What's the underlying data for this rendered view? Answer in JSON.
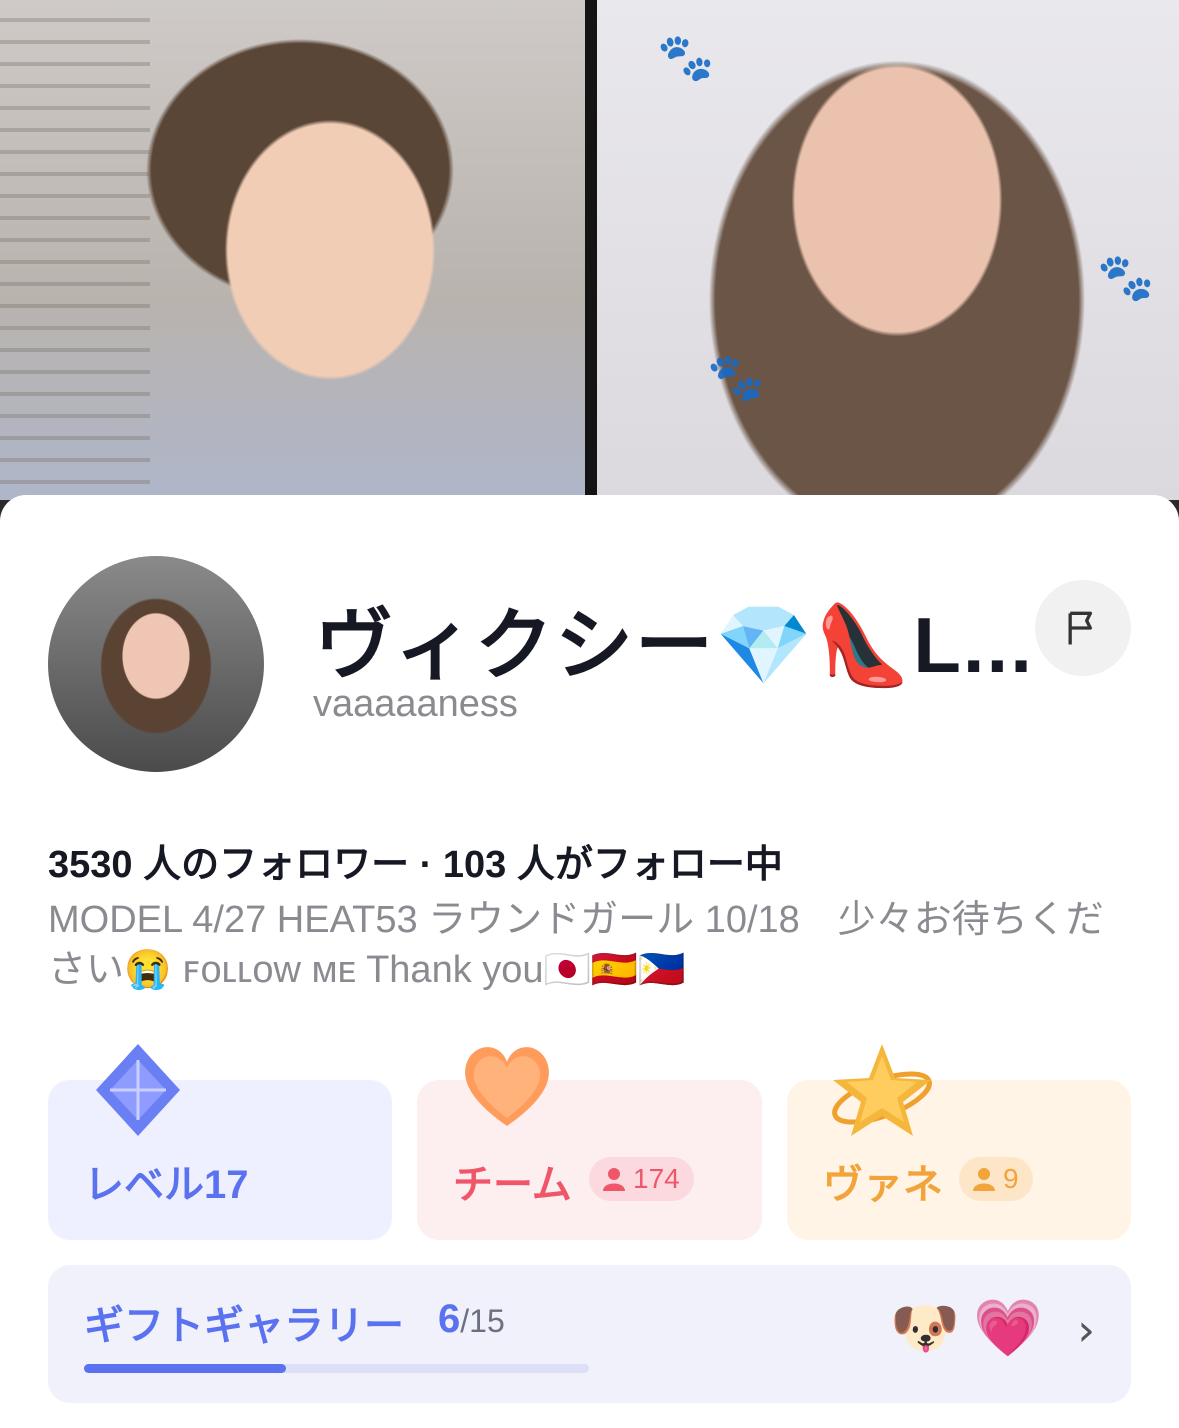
{
  "profile": {
    "display_name": "ヴィクシー💎👠L...",
    "username": "vaaaaaness",
    "stats": "3530 人のフォロワー · 103 人がフォロー中",
    "bio": "MODEL 4/27 HEAT53 ラウンドガール 10/18　少々お待ちください😭 ꜰᴏʟʟᴏᴡ ᴍᴇ Thank you🇯🇵🇪🇸🇵🇭"
  },
  "cards": {
    "level": {
      "label": "レベル17",
      "icon": "diamond-icon",
      "color": "#5a72f0"
    },
    "team": {
      "label": "チーム",
      "count": "174",
      "icon": "heart-icon",
      "color": "#f0566a"
    },
    "vane": {
      "label": "ヴァネ",
      "count": "9",
      "icon": "star-icon",
      "color": "#f2a33a"
    }
  },
  "gift_gallery": {
    "title": "ギフトギャラリー",
    "collected": "6",
    "total": "/15",
    "progress": 0.4,
    "gift_icons": [
      "corgi-gift-icon",
      "heart-gift-icon"
    ]
  }
}
